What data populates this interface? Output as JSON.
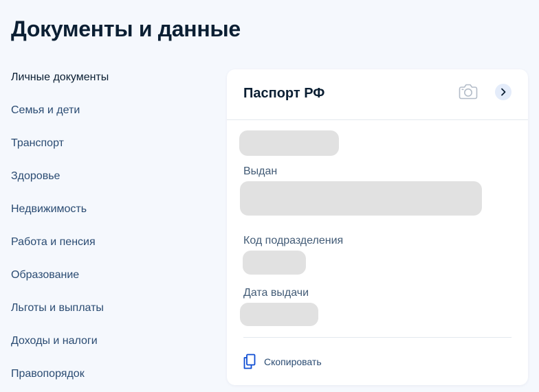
{
  "page": {
    "title": "Документы и данные"
  },
  "sidebar": {
    "items": [
      {
        "label": "Личные документы"
      },
      {
        "label": "Семья и дети"
      },
      {
        "label": "Транспорт"
      },
      {
        "label": "Здоровье"
      },
      {
        "label": "Недвижимость"
      },
      {
        "label": "Работа и пенсия"
      },
      {
        "label": "Образование"
      },
      {
        "label": "Льготы и выплаты"
      },
      {
        "label": "Доходы и налоги"
      },
      {
        "label": "Правопорядок"
      }
    ]
  },
  "passport_card": {
    "title": "Паспорт РФ",
    "issued_label": "Выдан",
    "division_code_label": "Код подразделения",
    "issue_date_label": "Дата выдачи",
    "copy_label": "Скопировать",
    "icons": {
      "camera": "camera-icon",
      "chevron": "chevron-right-icon",
      "copy": "copy-icon"
    }
  },
  "colors": {
    "background": "#f5f8fd",
    "card": "#ffffff",
    "title_text": "#0b1f33",
    "nav_text": "#2a4b72",
    "label_text": "#425b76",
    "skeleton": "#e1e1e1",
    "chevron_bg": "#e4ecfa"
  }
}
